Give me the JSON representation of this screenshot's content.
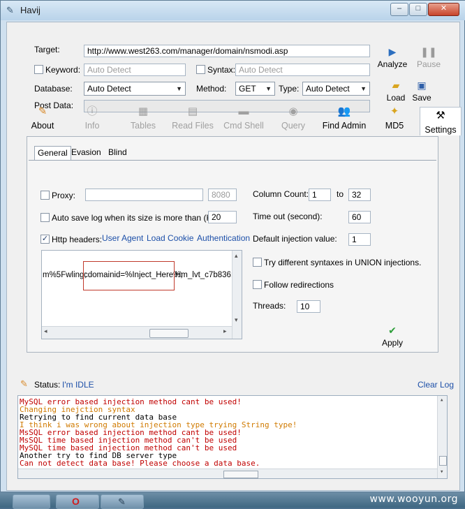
{
  "window": {
    "title": "Havij",
    "app_icon": "havij-pen-icon",
    "min": "–",
    "max": "□",
    "close": "✕"
  },
  "form": {
    "target_label": "Target:",
    "target_value": "http://www.west263.com/manager/domain/nsmodi.asp",
    "keyword_label": "Keyword:",
    "keyword_placeholder": "Auto Detect",
    "syntax_label": "Syntax:",
    "syntax_placeholder": "Auto Detect",
    "database_label": "Database:",
    "database_value": "Auto Detect",
    "method_label": "Method:",
    "method_value": "GET",
    "type_label": "Type:",
    "type_value": "Auto Detect",
    "postdata_label": "Post Data:"
  },
  "actions": {
    "analyze": "Analyze",
    "pause": "Pause",
    "load": "Load",
    "save": "Save"
  },
  "toolbar": {
    "about": "About",
    "info": "Info",
    "tables": "Tables",
    "read_files": "Read Files",
    "cmd_shell": "Cmd Shell",
    "query": "Query",
    "find_admin": "Find Admin",
    "md5": "MD5",
    "settings": "Settings"
  },
  "settings": {
    "tabs": [
      "General",
      "Evasion",
      "Blind"
    ],
    "proxy_label": "Proxy:",
    "proxy_port": "8080",
    "autosave_label": "Auto save log when its size is more than (KB):",
    "autosave_value": "20",
    "http_headers_label": "Http headers:",
    "links": [
      "User Agent",
      "Load Cookie",
      "Authentication"
    ],
    "headers_text_left": "m%5Fwling;",
    "headers_text_mid": "cdomainid=%Inject_Here%;",
    "headers_text_right": "Hm_lvt_c7b836:",
    "column_count_label": "Column Count:",
    "column_from": "1",
    "column_to_label": "to",
    "column_to": "32",
    "timeout_label": "Time out (second):",
    "timeout_value": "60",
    "default_injection_label": "Default injection value:",
    "default_injection_value": "1",
    "try_syntaxes_label": "Try different syntaxes in UNION injections.",
    "follow_redirections_label": "Follow redirections",
    "threads_label": "Threads:",
    "threads_value": "10",
    "apply_label": "Apply"
  },
  "status": {
    "label": "Status:",
    "value": "I'm IDLE",
    "clear_log": "Clear Log"
  },
  "log": [
    {
      "text": "MySQL error based injection method cant be used!",
      "color": "#c00000"
    },
    {
      "text": "Changing inejction syntax",
      "color": "#d07a00"
    },
    {
      "text": "Retrying to find current data base",
      "color": "#000000"
    },
    {
      "text": "I think i was wrong about injection type trying String type!",
      "color": "#d07a00"
    },
    {
      "text": "MsSQL error based injection method cant be used!",
      "color": "#c00000"
    },
    {
      "text": "MsSQL time based injection method can't be used",
      "color": "#c00000"
    },
    {
      "text": "MySQL time based injection method can't be used",
      "color": "#c00000"
    },
    {
      "text": "Another try to find DB server type",
      "color": "#000000"
    },
    {
      "text": "Can not detect data base! Please choose a data base.",
      "color": "#c00000"
    }
  ],
  "taskbar": {
    "watermark": "www.wooyun.org"
  },
  "colors": {
    "link": "#1c4fa8",
    "error": "#c00000",
    "warning": "#d07a00",
    "highlight_box": "#c0392b"
  }
}
